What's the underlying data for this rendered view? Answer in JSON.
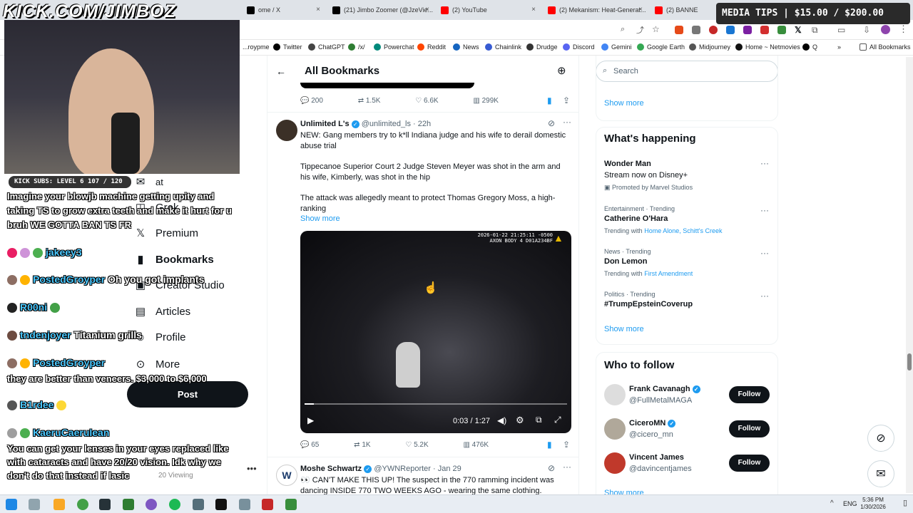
{
  "overlay": {
    "logo": "KICK.COM/JIMBOZ",
    "media_tips": "MEDIA TIPS | $15.00 / $200.00",
    "subs": "KICK SUBS: LEVEL 6 107 / 120",
    "chat": [
      {
        "user": "",
        "text": "Imagine your blowjb machine getting upity and taking TS to grow extra teeth and make it hurt for u bruh WE GOTTA BAN TS FR"
      },
      {
        "user": "jakeey3",
        "text": ""
      },
      {
        "user": "PostedGroyper",
        "text": "Oh you got implants"
      },
      {
        "user": "R00ni",
        "text": ""
      },
      {
        "user": "tndenjoyer",
        "text": "Titanium grills"
      },
      {
        "user": "PostedGroyper",
        "text": "they are better than veneers. $3,000 to $6,000"
      },
      {
        "user": "B1rdee",
        "text": ""
      },
      {
        "user": "KaeruCaeruIean",
        "text": "You can get your lenses in your eyes replaced like with cataracts and have 20/20 vision. Idk why we don't do that instead if lasic"
      }
    ],
    "viewing": "20 Viewing"
  },
  "tabs": [
    {
      "label": "ome / X",
      "color": "#000000"
    },
    {
      "label": "(21) Jimbo Zoomer (@JzeVie...",
      "color": "#000000"
    },
    {
      "label": "(2) YouTube",
      "color": "#ff0000"
    },
    {
      "label": "(2) Mekanism: Heat-Generat...",
      "color": "#ff0000"
    },
    {
      "label": "(2) BANNE",
      "color": "#ff0000"
    }
  ],
  "bookmarks": [
    "...roypme",
    "Twitter",
    "ChatGPT",
    "/x/",
    "Powerchat",
    "Reddit",
    "News",
    "Chainlink",
    "Drudge",
    "Discord",
    "Gemini",
    "Google Earth",
    "Midjourney",
    "Home ~ Netmovies",
    "Q",
    "All Bookmarks"
  ],
  "nav": {
    "items": [
      "at",
      "Grok",
      "Premium",
      "Bookmarks",
      "Creator Studio",
      "Articles",
      "Profile",
      "More"
    ],
    "post": "Post"
  },
  "header": {
    "title": "All Bookmarks"
  },
  "tweet0": {
    "replies": "200",
    "retweets": "1.5K",
    "likes": "6.6K",
    "views": "299K"
  },
  "tweet1": {
    "name": "Unlimited L's",
    "handle": "@unlimited_ls · 22h",
    "p1": "NEW: Gang members try to k*ll Indiana judge and his wife to derail domestic abuse trial",
    "p2": "Tippecanoe Superior Court 2 Judge Steven Meyer was shot in the arm and his wife, Kimberly, was shot in the hip",
    "p3": "The attack was allegedly meant to protect Thomas Gregory Moss, a high-ranking",
    "show_more": "Show more",
    "video_stamp": "2026-01-22 21:25:11 -0500",
    "video_stamp2": "AXON BODY 4 D01A234BF",
    "time": "0:03 / 1:27",
    "progress": 0.034,
    "replies": "65",
    "retweets": "1K",
    "likes": "5.2K",
    "views": "476K"
  },
  "tweet2": {
    "name": "Moshe Schwartz",
    "handle": "@YWNReporter · Jan 29",
    "text": "👀 CAN'T MAKE THIS UP! The suspect in the 770 ramming incident was dancing INSIDE 770 TWO WEEKS AGO - wearing the same clothing."
  },
  "right": {
    "search_placeholder": "Search",
    "show_more_top": "Show more",
    "happening_title": "What's happening",
    "trends": [
      {
        "meta": "",
        "title": "Wonder Man",
        "sub": "Stream now on Disney+",
        "extra": "Promoted by Marvel Studios"
      },
      {
        "meta": "Entertainment · Trending",
        "title": "Catherine O'Hara",
        "sub": "Trending with",
        "links": "Home Alone, Schitt's Creek"
      },
      {
        "meta": "News · Trending",
        "title": "Don Lemon",
        "sub": "Trending with",
        "links": "First Amendment"
      },
      {
        "meta": "Politics · Trending",
        "title": "#TrumpEpsteinCoverup",
        "sub": "",
        "links": ""
      }
    ],
    "show_more_trends": "Show more",
    "who_title": "Who to follow",
    "follow": [
      {
        "name": "Frank Cavanagh",
        "handle": "@FullMetalMAGA",
        "btn": "Follow"
      },
      {
        "name": "CiceroMN",
        "handle": "@cicero_mn",
        "btn": "Follow"
      },
      {
        "name": "Vincent James",
        "handle": "@davincentjames",
        "btn": "Follow"
      }
    ],
    "show_more_follow": "Show more"
  },
  "taskbar": {
    "lang": "ENG",
    "time": "5:36 PM",
    "date": "1/30/2026"
  }
}
